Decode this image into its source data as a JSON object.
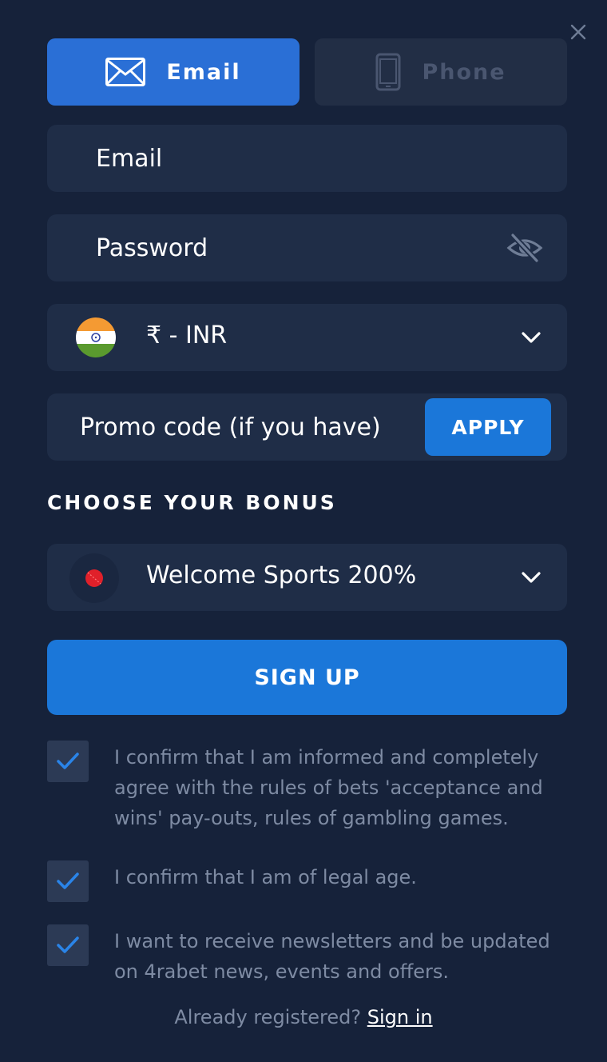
{
  "icons": {
    "close": "close-icon",
    "email_tab": "envelope-icon",
    "phone_tab": "smartphone-icon",
    "password_toggle": "eye-slash-icon",
    "currency_flag": "india-flag-icon",
    "dropdown": "chevron-down-icon",
    "bonus": "cricket-ball-icon",
    "checkbox": "checkmark-icon"
  },
  "colors": {
    "background": "#16223a",
    "field_background": "#1f2d47",
    "primary_button": "#1b77d9",
    "active_tab": "#2a6fd6",
    "muted_text": "#7e8ba3"
  },
  "tabs": {
    "email_label": "Email",
    "phone_label": "Phone"
  },
  "fields": {
    "email_placeholder": "Email",
    "password_placeholder": "Password",
    "currency_value": "₹  -  INR",
    "promo_placeholder": "Promo code (if you have)",
    "apply_label": "APPLY"
  },
  "bonus": {
    "heading": "CHOOSE YOUR BONUS",
    "selected": "Welcome Sports 200%"
  },
  "signup_label": "SIGN UP",
  "checkboxes": [
    {
      "text": "I confirm that I am informed and completely agree with the rules of bets 'acceptance and wins' pay-outs, rules of gambling games.",
      "checked": true
    },
    {
      "text": "I confirm that I am of legal age.",
      "checked": true
    },
    {
      "text": "I want to receive newsletters and be updated on 4rabet news, events and offers.",
      "checked": true
    }
  ],
  "footer": {
    "prompt": "Already registered?",
    "link": "Sign in"
  }
}
